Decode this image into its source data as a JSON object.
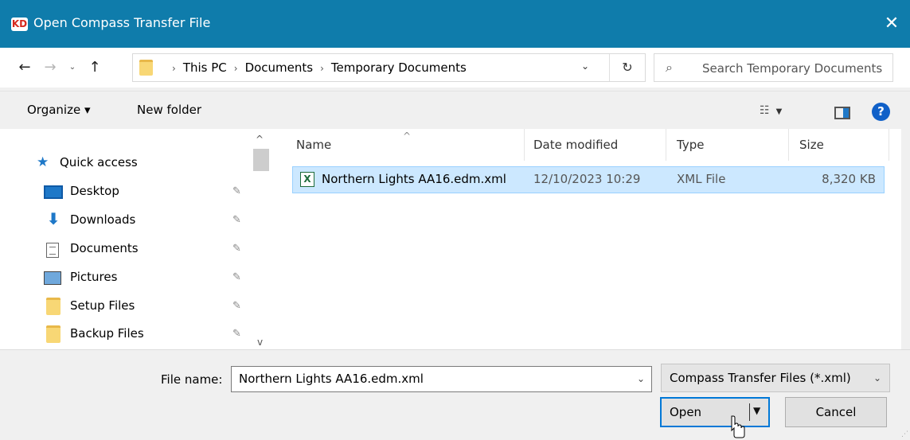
{
  "window": {
    "app_icon_text": "KD",
    "title": "Open Compass Transfer File",
    "close_glyph": "✕"
  },
  "nav": {
    "back_glyph": "←",
    "forward_glyph": "→",
    "recent_glyph": "⌄",
    "up_glyph": "↑",
    "breadcrumb": [
      "This PC",
      "Documents",
      "Temporary Documents"
    ],
    "separator": "›",
    "address_dropdown_glyph": "⌄",
    "refresh_glyph": "↻",
    "search_placeholder": "Search Temporary Documents"
  },
  "toolbar": {
    "organize_label": "Organize ▾",
    "new_folder_label": "New folder",
    "view_glyph": "☷",
    "view_caret": "▼",
    "help_glyph": "?"
  },
  "sidebar": {
    "items": [
      {
        "label": "Quick access",
        "icon": "star-icon"
      },
      {
        "label": "Desktop",
        "icon": "desktop-icon"
      },
      {
        "label": "Downloads",
        "icon": "download-icon"
      },
      {
        "label": "Documents",
        "icon": "documents-icon"
      },
      {
        "label": "Pictures",
        "icon": "pictures-icon"
      },
      {
        "label": "Setup Files",
        "icon": "folder-icon"
      },
      {
        "label": "Backup Files",
        "icon": "folder-icon"
      }
    ],
    "pin_glyph": "📌",
    "scroll_up_glyph": "^",
    "scroll_down_glyph": "v"
  },
  "files": {
    "columns": [
      "Name",
      "Date modified",
      "Type",
      "Size"
    ],
    "sort_glyph": "^",
    "rows": [
      {
        "icon_text": "X",
        "name": "Northern Lights AA16.edm.xml",
        "date": "12/10/2023 10:29",
        "type": "XML File",
        "size": "8,320 KB"
      }
    ]
  },
  "footer": {
    "file_name_label": "File name:",
    "file_name_value": "Northern Lights AA16.edm.xml",
    "file_dropdown_glyph": "⌄",
    "filter_value": "Compass Transfer Files (*.xml)",
    "filter_dropdown_glyph": "⌄",
    "open_label": "Open",
    "open_split_glyph": "▼",
    "cancel_label": "Cancel",
    "grip_glyph": "⋰"
  },
  "colors": {
    "titlebar": "#0f7cab",
    "selection": "#cce8ff",
    "accent": "#0078d7"
  }
}
